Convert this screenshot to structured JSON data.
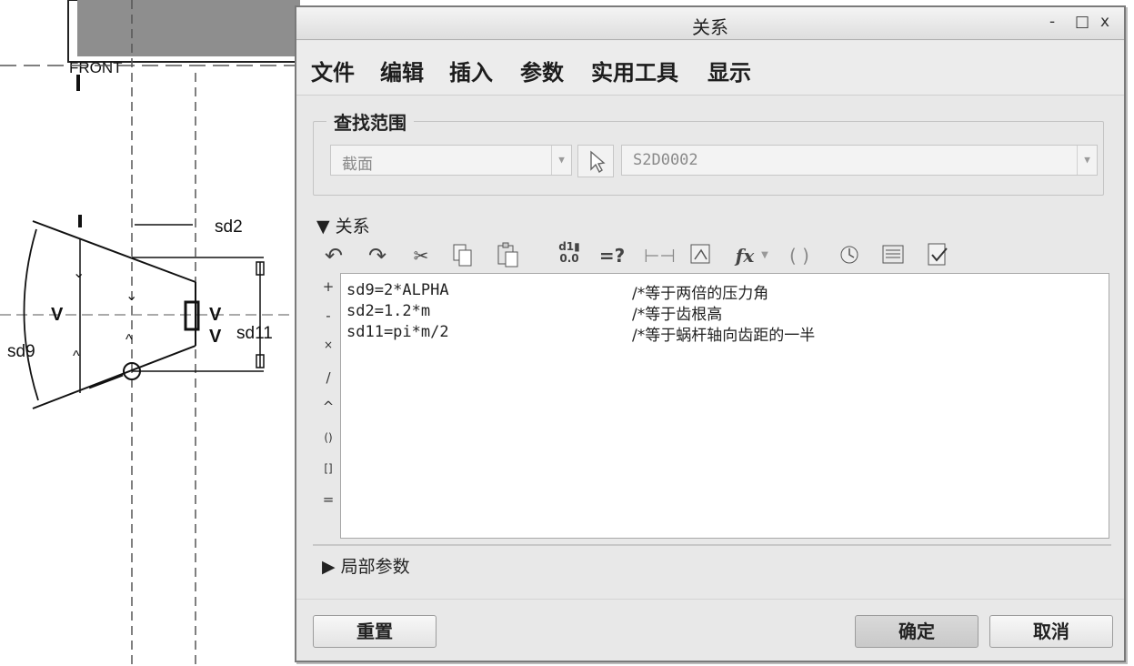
{
  "window": {
    "title": "关系",
    "controls": [
      "-",
      "□",
      "x"
    ]
  },
  "menu": [
    "文件",
    "编辑",
    "插入",
    "参数",
    "实用工具",
    "显示"
  ],
  "search": {
    "legend": "查找范围",
    "scope_value": "截面",
    "target_value": "S2D0002"
  },
  "relations": {
    "header": "关系",
    "toolbar_icons": [
      "undo-icon",
      "redo-icon",
      "cut-icon",
      "copy-icon",
      "paste-icon",
      "switch-symbols-icon",
      "evaluate-icon",
      "dimension-icon",
      "units-icon",
      "function-icon",
      "brackets-icon",
      "sort-icon",
      "sheet-icon",
      "verify-icon"
    ],
    "toolbar": {
      "function": "fx",
      "evaluate": "=?",
      "brackets": "( )",
      "dim_top": "d1",
      "dim_bottom": "0.0"
    },
    "operators": [
      "+",
      "-",
      "×",
      "/",
      "^",
      "()",
      "[]",
      "="
    ],
    "lines": [
      {
        "code": "sd9=2*ALPHA",
        "comment": "/*等于两倍的压力角"
      },
      {
        "code": "sd2=1.2*m",
        "comment": "/*等于齿根高"
      },
      {
        "code": "sd11=pi*m/2",
        "comment": "/*等于蜗杆轴向齿距的一半"
      }
    ]
  },
  "local_params": "局部参数",
  "buttons": {
    "reset": "重置",
    "ok": "确定",
    "cancel": "取消"
  },
  "sketch": {
    "front_label": "FRONT",
    "dims": {
      "sd2": "sd2",
      "sd9": "sd9",
      "sd11": "sd11"
    },
    "constraints": [
      "V",
      "V",
      "V"
    ]
  }
}
